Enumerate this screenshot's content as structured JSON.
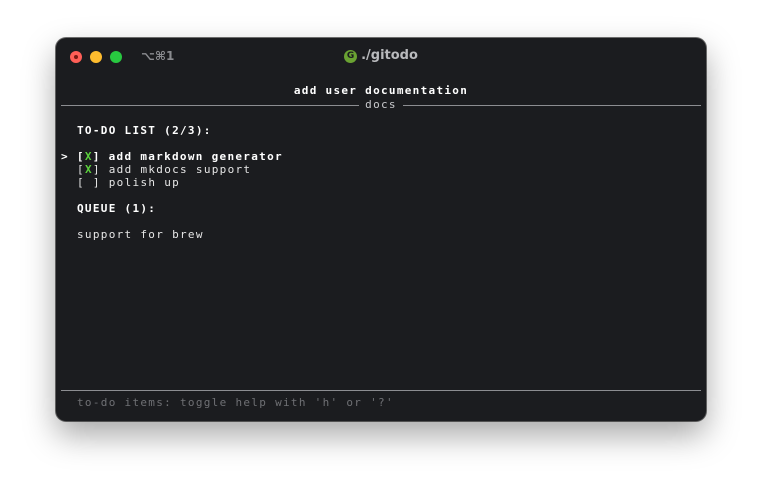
{
  "titlebar": {
    "shortcut": "⌥⌘1",
    "app_icon_letter": "G",
    "title": "./gitodo"
  },
  "panel": {
    "heading": "add user documentation",
    "tag": "docs"
  },
  "todo": {
    "title": "TO-DO LIST (2/3):",
    "items": [
      {
        "cursor": ">",
        "checkbox_open": "[",
        "mark": "X",
        "checkbox_close": "]",
        "label": "add markdown generator",
        "selected": true
      },
      {
        "cursor": "",
        "checkbox_open": "[",
        "mark": "X",
        "checkbox_close": "]",
        "label": "add mkdocs support",
        "selected": false
      },
      {
        "cursor": "",
        "checkbox_open": "[",
        "mark": " ",
        "checkbox_close": "]",
        "label": "polish up",
        "selected": false
      }
    ]
  },
  "queue": {
    "title": "QUEUE (1):",
    "items": [
      "support for brew"
    ]
  },
  "footer": {
    "hint": "to-do items: toggle help with 'h' or '?'"
  },
  "colors": {
    "window_bg": "#1b1c1f",
    "check_green": "#5cd13d",
    "close": "#ff5f57",
    "minimize": "#febc2e",
    "maximize": "#28c840"
  }
}
